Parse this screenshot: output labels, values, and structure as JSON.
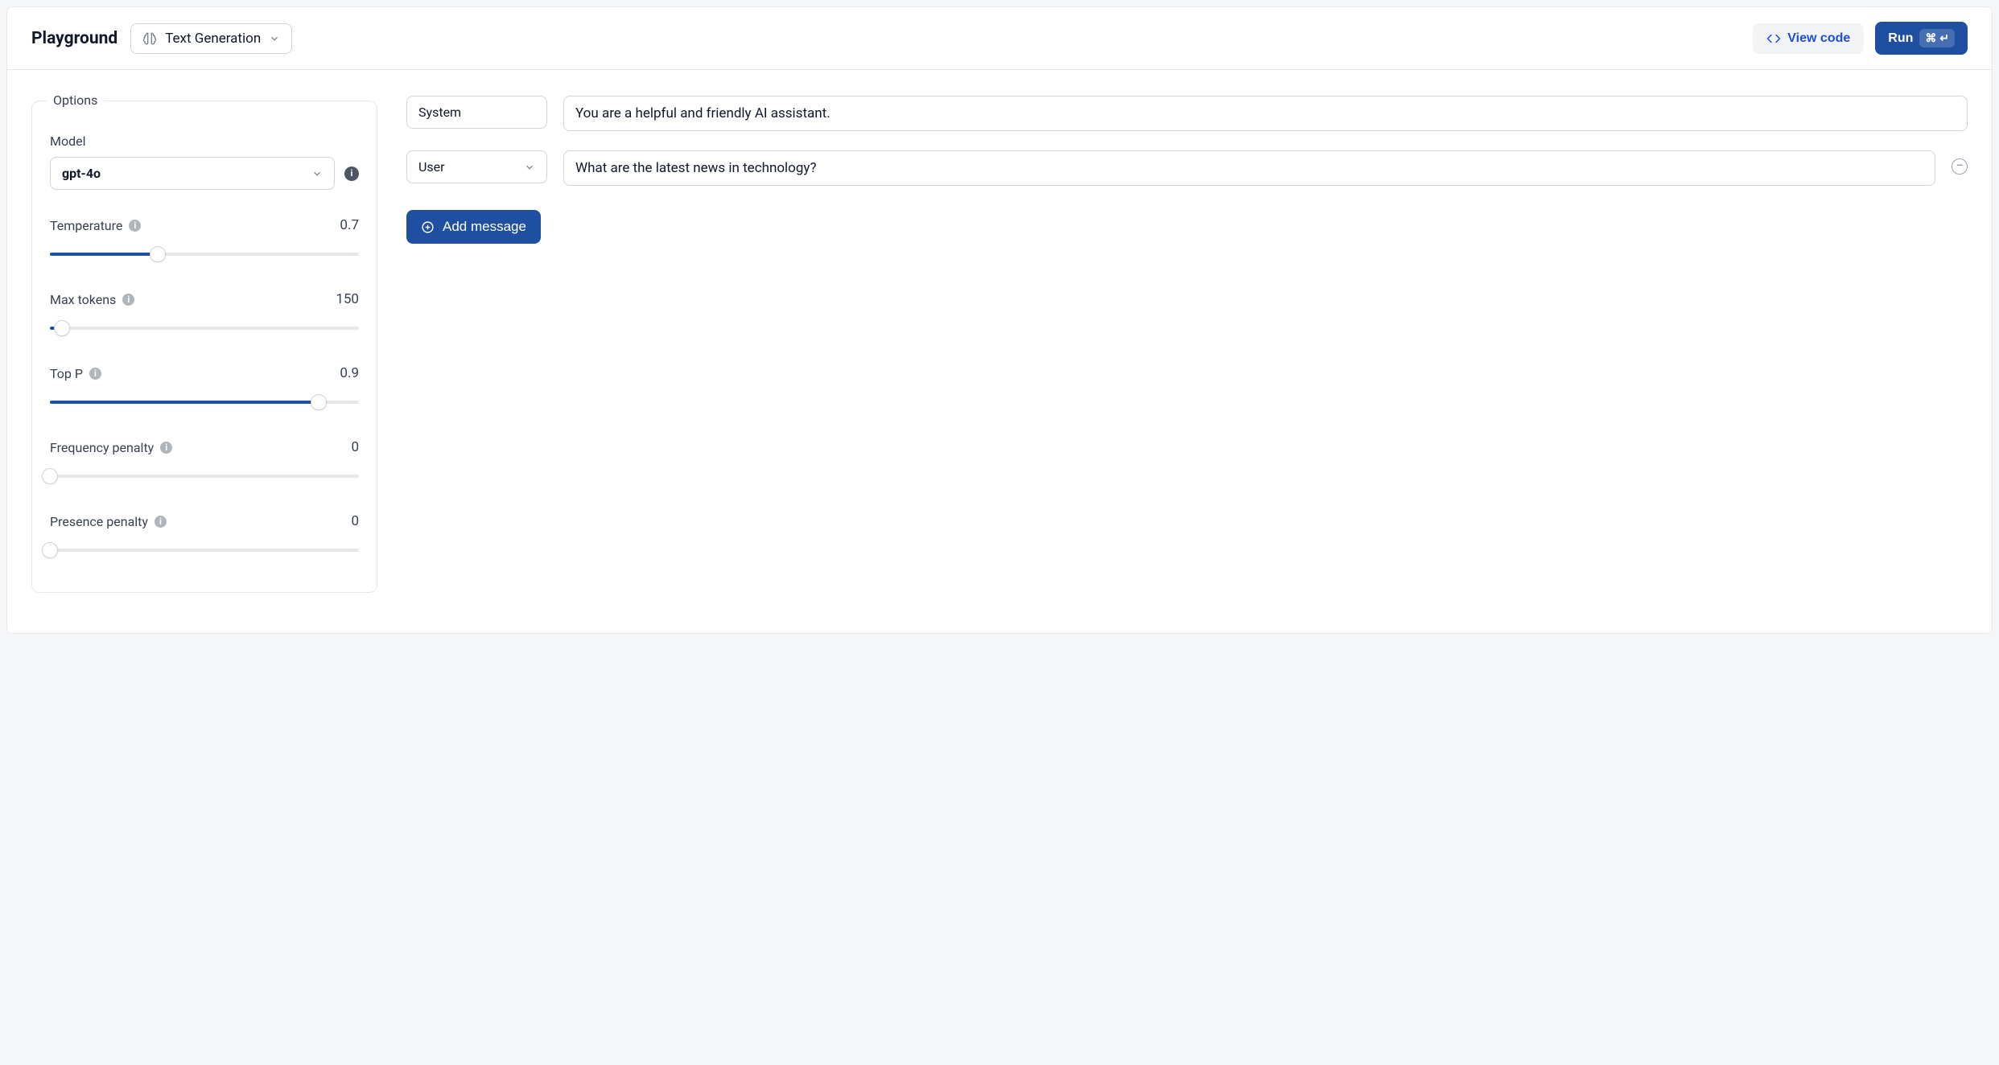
{
  "header": {
    "title": "Playground",
    "mode_label": "Text Generation",
    "view_code_label": "View code",
    "run_label": "Run",
    "run_shortcut": "⌘ ↵"
  },
  "options": {
    "legend": "Options",
    "model_label": "Model",
    "model_value": "gpt-4o",
    "sliders": [
      {
        "name": "Temperature",
        "value": "0.7",
        "fill_pct": 35
      },
      {
        "name": "Max tokens",
        "value": "150",
        "fill_pct": 4
      },
      {
        "name": "Top P",
        "value": "0.9",
        "fill_pct": 87
      },
      {
        "name": "Frequency penalty",
        "value": "0",
        "fill_pct": 0
      },
      {
        "name": "Presence penalty",
        "value": "0",
        "fill_pct": 0
      }
    ]
  },
  "messages": {
    "system_role": "System",
    "system_value": "You are a helpful and friendly AI assistant.",
    "user_role": "User",
    "user_value": "What are the latest news in technology?",
    "add_label": "Add message"
  }
}
